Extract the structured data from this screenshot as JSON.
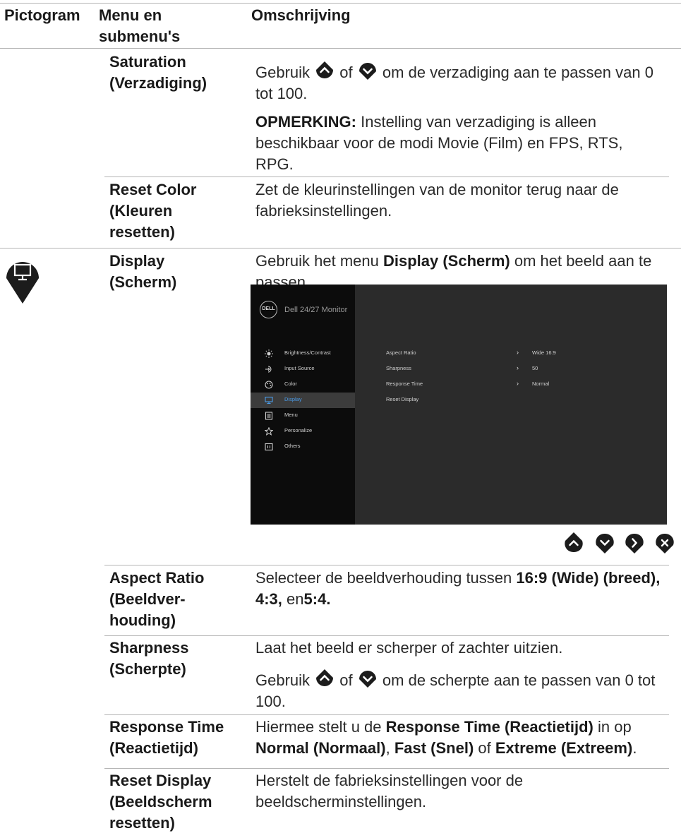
{
  "header": {
    "col1": "Pictogram",
    "col2": "Menu en\nsubmenu's",
    "col3": "Omschrijving"
  },
  "rows": {
    "saturation": {
      "name": "Saturation\n(Verzadiging)",
      "p1_a": "Gebruik",
      "p1_b": "of",
      "p1_c": "om de verzadiging aan te passen van 0 tot 100.",
      "note_label": "OPMERKING:",
      "note_text": " Instelling van verzadiging is alleen beschikbaar voor de modi Movie (Film) en FPS, RTS, RPG."
    },
    "reset_color": {
      "name": "Reset Color\n(Kleuren\nresetten)",
      "text": "Zet de kleurinstellingen van de monitor terug naar de fabrieksinstellingen."
    },
    "display": {
      "name": "Display\n(Scherm)",
      "text_a": "Gebruik het menu ",
      "text_bold": "Display (Scherm)",
      "text_b": " om het beeld aan te passen."
    },
    "aspect_ratio": {
      "name": "Aspect Ratio\n(Beeldver-\nhouding)",
      "text_a": "Selecteer de beeldverhouding tussen ",
      "text_bold": "16:9 (Wide) (breed), 4:3,",
      "text_b": " en",
      "text_bold2": "5:4."
    },
    "sharpness": {
      "name": "Sharpness\n(Scherpte)",
      "p1": "Laat het beeld er scherper of zachter uitzien.",
      "p2_a": "Gebruik",
      "p2_b": "of",
      "p2_c": "om de scherpte aan te passen van 0 tot 100."
    },
    "response_time": {
      "name": "Response Time\n(Reactietijd)",
      "t1": "Hiermee stelt u de ",
      "b1": "Response Time (Reactietijd)",
      "t2": " in op ",
      "b2": "Normal (Normaal)",
      "t3": ", ",
      "b3": "Fast (Snel)",
      "t4": " of ",
      "b4": "Extreme (Extreem)",
      "t5": "."
    },
    "reset_display": {
      "name": "Reset Display\n(Beeldscherm\nresetten)",
      "text": "Herstelt de fabrieksinstellingen voor de beeldscherminstellingen."
    }
  },
  "osd": {
    "logo": "DELL",
    "title": "Dell 24/27 Monitor",
    "menu": [
      {
        "label": "Brightness/Contrast",
        "icon": "brightness-icon"
      },
      {
        "label": "Input Source",
        "icon": "input-source-icon"
      },
      {
        "label": "Color",
        "icon": "color-icon"
      },
      {
        "label": "Display",
        "icon": "display-icon",
        "selected": true
      },
      {
        "label": "Menu",
        "icon": "menu-icon"
      },
      {
        "label": "Personalize",
        "icon": "star-icon"
      },
      {
        "label": "Others",
        "icon": "others-icon"
      }
    ],
    "settings": [
      {
        "label": "Aspect Ratio",
        "value": "Wide 16:9"
      },
      {
        "label": "Sharpness",
        "value": "50"
      },
      {
        "label": "Response Time",
        "value": "Normal"
      },
      {
        "label": "Reset Display",
        "value": ""
      }
    ],
    "arrow": "›"
  },
  "icons": {
    "display_category": "display-pin-icon",
    "up": "up-button-icon",
    "down": "down-button-icon",
    "right": "right-button-icon",
    "close": "close-button-icon",
    "pin_color": "#1c1c1c"
  }
}
